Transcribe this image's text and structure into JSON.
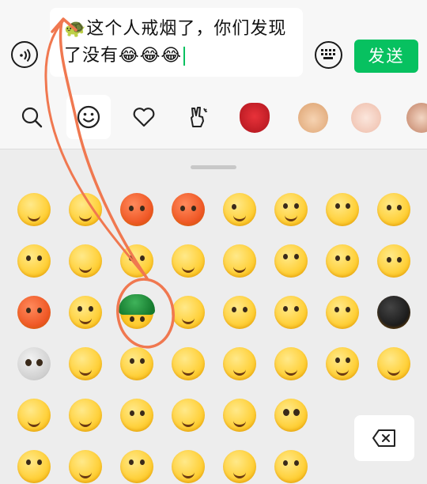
{
  "input": {
    "line1": "🐢这个人戒烟了，你们发现",
    "line2": "了没有😂😂😂"
  },
  "send_button": {
    "label": "发送",
    "color": "#07c160"
  },
  "tabs": [
    "search-icon",
    "smiley-icon",
    "heart-icon",
    "peace-hand-icon",
    "crab-sticker",
    "baby-sticker",
    "bald-baby-sticker",
    "girl-sticker"
  ],
  "emoji_grid": {
    "rows": 6,
    "cols": 8,
    "highlighted": "turtle-emoji"
  },
  "annotation_color": "#f07850"
}
